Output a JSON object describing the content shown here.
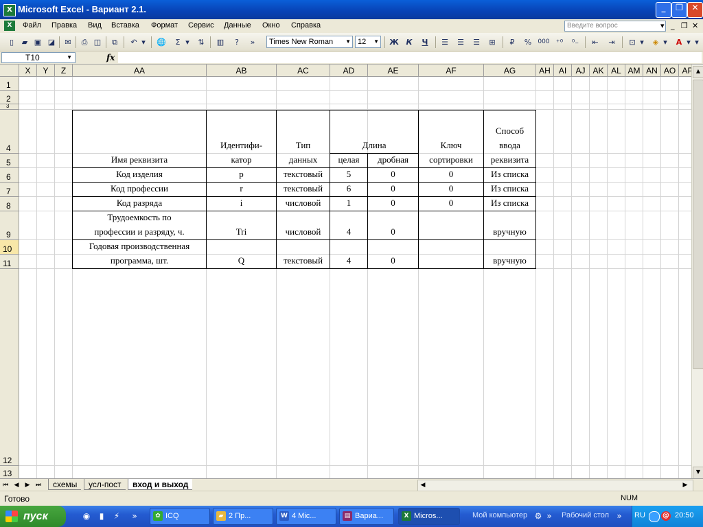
{
  "window": {
    "title": "Microsoft Excel - Вариант 2.1.",
    "app_icon": "excel-icon"
  },
  "menu": {
    "items": [
      "Файл",
      "Правка",
      "Вид",
      "Вставка",
      "Формат",
      "Сервис",
      "Данные",
      "Окно",
      "Справка"
    ],
    "help_placeholder": "Введите вопрос"
  },
  "toolbar": {
    "font": "Times New Roman",
    "size": "12",
    "bold": "Ж",
    "italic": "К",
    "underline": "Ч",
    "sigma": "Σ",
    "percent": "%",
    "thousands": "000"
  },
  "formula_bar": {
    "name_box": "T10",
    "fx": "fx",
    "content": ""
  },
  "columns": [
    "X",
    "Y",
    "Z",
    "AA",
    "AB",
    "AC",
    "AD",
    "AE",
    "AF",
    "AG",
    "AH",
    "AI",
    "AJ",
    "AK",
    "AL",
    "AM",
    "AN",
    "AO",
    "AP"
  ],
  "rows": [
    "1",
    "2",
    "3",
    "4",
    "5",
    "6",
    "7",
    "8",
    "9",
    "10",
    "11",
    "12",
    "13"
  ],
  "table": {
    "header": {
      "name": "Имя реквизита",
      "identifier": "Идентифи-\nкатор",
      "type": "Тип\nданных",
      "length": "Длина",
      "length_whole": "целая",
      "length_fraction": "дробная",
      "sort_key": "Ключ\nсортировки",
      "input_method": "Способ\nввода\nреквизита"
    },
    "rows": [
      {
        "name": "Код изделия",
        "id": "p",
        "type": "текстовый",
        "whole": "5",
        "frac": "0",
        "key": "0",
        "input": "Из списка"
      },
      {
        "name": "Код профессии",
        "id": "r",
        "type": "текстовый",
        "whole": "6",
        "frac": "0",
        "key": "0",
        "input": "Из списка"
      },
      {
        "name": "Код разряда",
        "id": "i",
        "type": "числовой",
        "whole": "1",
        "frac": "0",
        "key": "0",
        "input": "Из списка"
      },
      {
        "name": "Трудоемкость по\nпрофессии и разряду, ч.",
        "id": "Tri",
        "type": "числовой",
        "whole": "4",
        "frac": "0",
        "key": "",
        "input": "вручную"
      },
      {
        "name": "Годовая производственная\nпрограмма, шт.",
        "id": "Q",
        "type": "текстовый",
        "whole": "4",
        "frac": "0",
        "key": "",
        "input": "вручную"
      }
    ]
  },
  "sheet_tabs": [
    "схемы",
    "усл-пост",
    "вход и выход"
  ],
  "active_sheet": "вход и выход",
  "status": {
    "left": "Готово",
    "num": "NUM"
  },
  "taskbar": {
    "start": "пуск",
    "items": [
      "ICQ",
      "2 Пр...",
      "4 Mic...",
      "Вариа...",
      "Micros..."
    ],
    "tools": [
      "Мой компьютер",
      "Рабочий стол"
    ],
    "lang": "RU",
    "clock": "20:50"
  }
}
